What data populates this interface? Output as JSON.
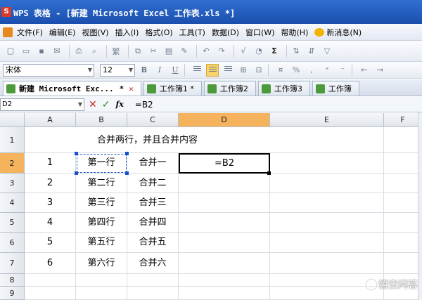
{
  "titlebar": {
    "title": "WPS 表格 - [新建 Microsoft Excel 工作表.xls *]"
  },
  "menu": [
    "文件(F)",
    "编辑(E)",
    "视图(V)",
    "插入(I)",
    "格式(O)",
    "工具(T)",
    "数据(D)",
    "窗口(W)",
    "帮助(H)"
  ],
  "news_label": "新消息(N)",
  "format": {
    "font": "宋体",
    "size": "12",
    "bold": "B",
    "italic": "I",
    "underline": "U"
  },
  "tabs": [
    {
      "label": "新建 Microsoft Exc..."
    },
    {
      "label": "工作簿1 *"
    },
    {
      "label": "工作簿2"
    },
    {
      "label": "工作簿3"
    },
    {
      "label": "工作簿"
    }
  ],
  "formula_bar": {
    "name_box": "D2",
    "fx": "fx",
    "formula": "=B2"
  },
  "columns": [
    "A",
    "B",
    "C",
    "D",
    "E",
    "F"
  ],
  "row_numbers": [
    "1",
    "2",
    "3",
    "4",
    "5",
    "6",
    "7",
    "8",
    "9"
  ],
  "merged_title": "合并两行，并且合并内容",
  "rows": [
    {
      "a": "1",
      "b": "第一行",
      "c": "合并一",
      "d": "=B2"
    },
    {
      "a": "2",
      "b": "第二行",
      "c": "合并二",
      "d": ""
    },
    {
      "a": "3",
      "b": "第三行",
      "c": "合并三",
      "d": ""
    },
    {
      "a": "4",
      "b": "第四行",
      "c": "合并四",
      "d": ""
    },
    {
      "a": "5",
      "b": "第五行",
      "c": "合并五",
      "d": ""
    },
    {
      "a": "6",
      "b": "第六行",
      "c": "合并六",
      "d": ""
    }
  ],
  "watermark": "悟空问答",
  "colors": {
    "titlebar": "#1b4fae",
    "active_header": "#f4b35c",
    "selection": "#2b5fc6"
  }
}
